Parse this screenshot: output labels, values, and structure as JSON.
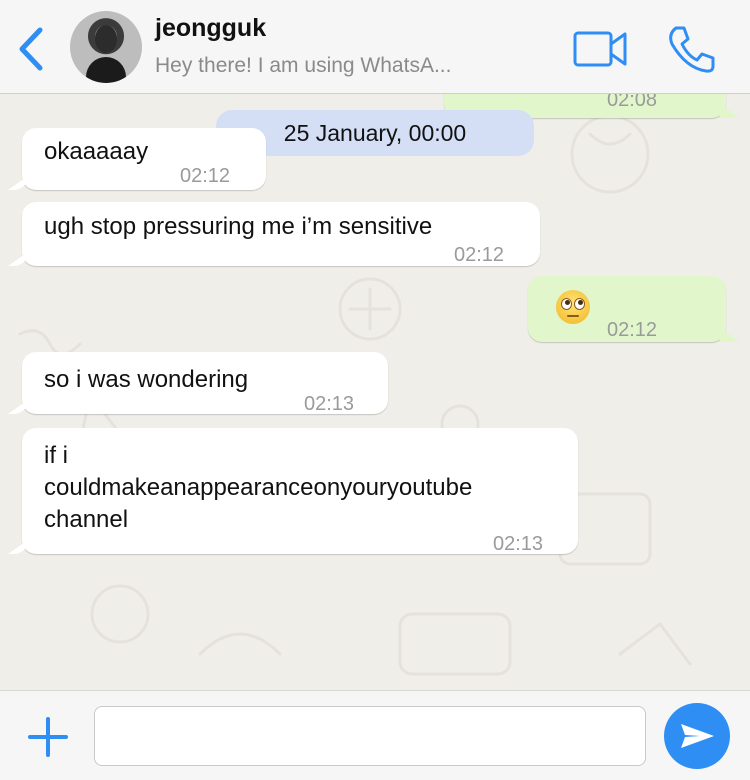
{
  "header": {
    "back_icon": "chevron-left-icon",
    "contact_name": "jeongguk",
    "contact_status": "Hey there! I am using WhatsA...",
    "video_icon": "video-camera-icon",
    "call_icon": "phone-icon",
    "accent_color": "#2f8ef4"
  },
  "chat": {
    "partial_message_time": "02:08",
    "date_divider": "25 January, 00:00",
    "messages": [
      {
        "direction": "incoming",
        "text": "okaaaaay",
        "time": "02:12"
      },
      {
        "direction": "incoming",
        "text": "ugh stop pressuring me i’m sensitive",
        "time": "02:12"
      },
      {
        "direction": "outgoing",
        "emoji": "face-with-rolling-eyes",
        "time": "02:12"
      },
      {
        "direction": "incoming",
        "text": "so i was wondering",
        "time": "02:13"
      },
      {
        "direction": "incoming",
        "lines": [
          "if i",
          "couldmakeanappearanceonyouryoutube",
          "channel"
        ],
        "time": "02:13"
      }
    ]
  },
  "composer": {
    "plus_icon": "plus-icon",
    "input_value": "",
    "send_icon": "send-icon"
  }
}
